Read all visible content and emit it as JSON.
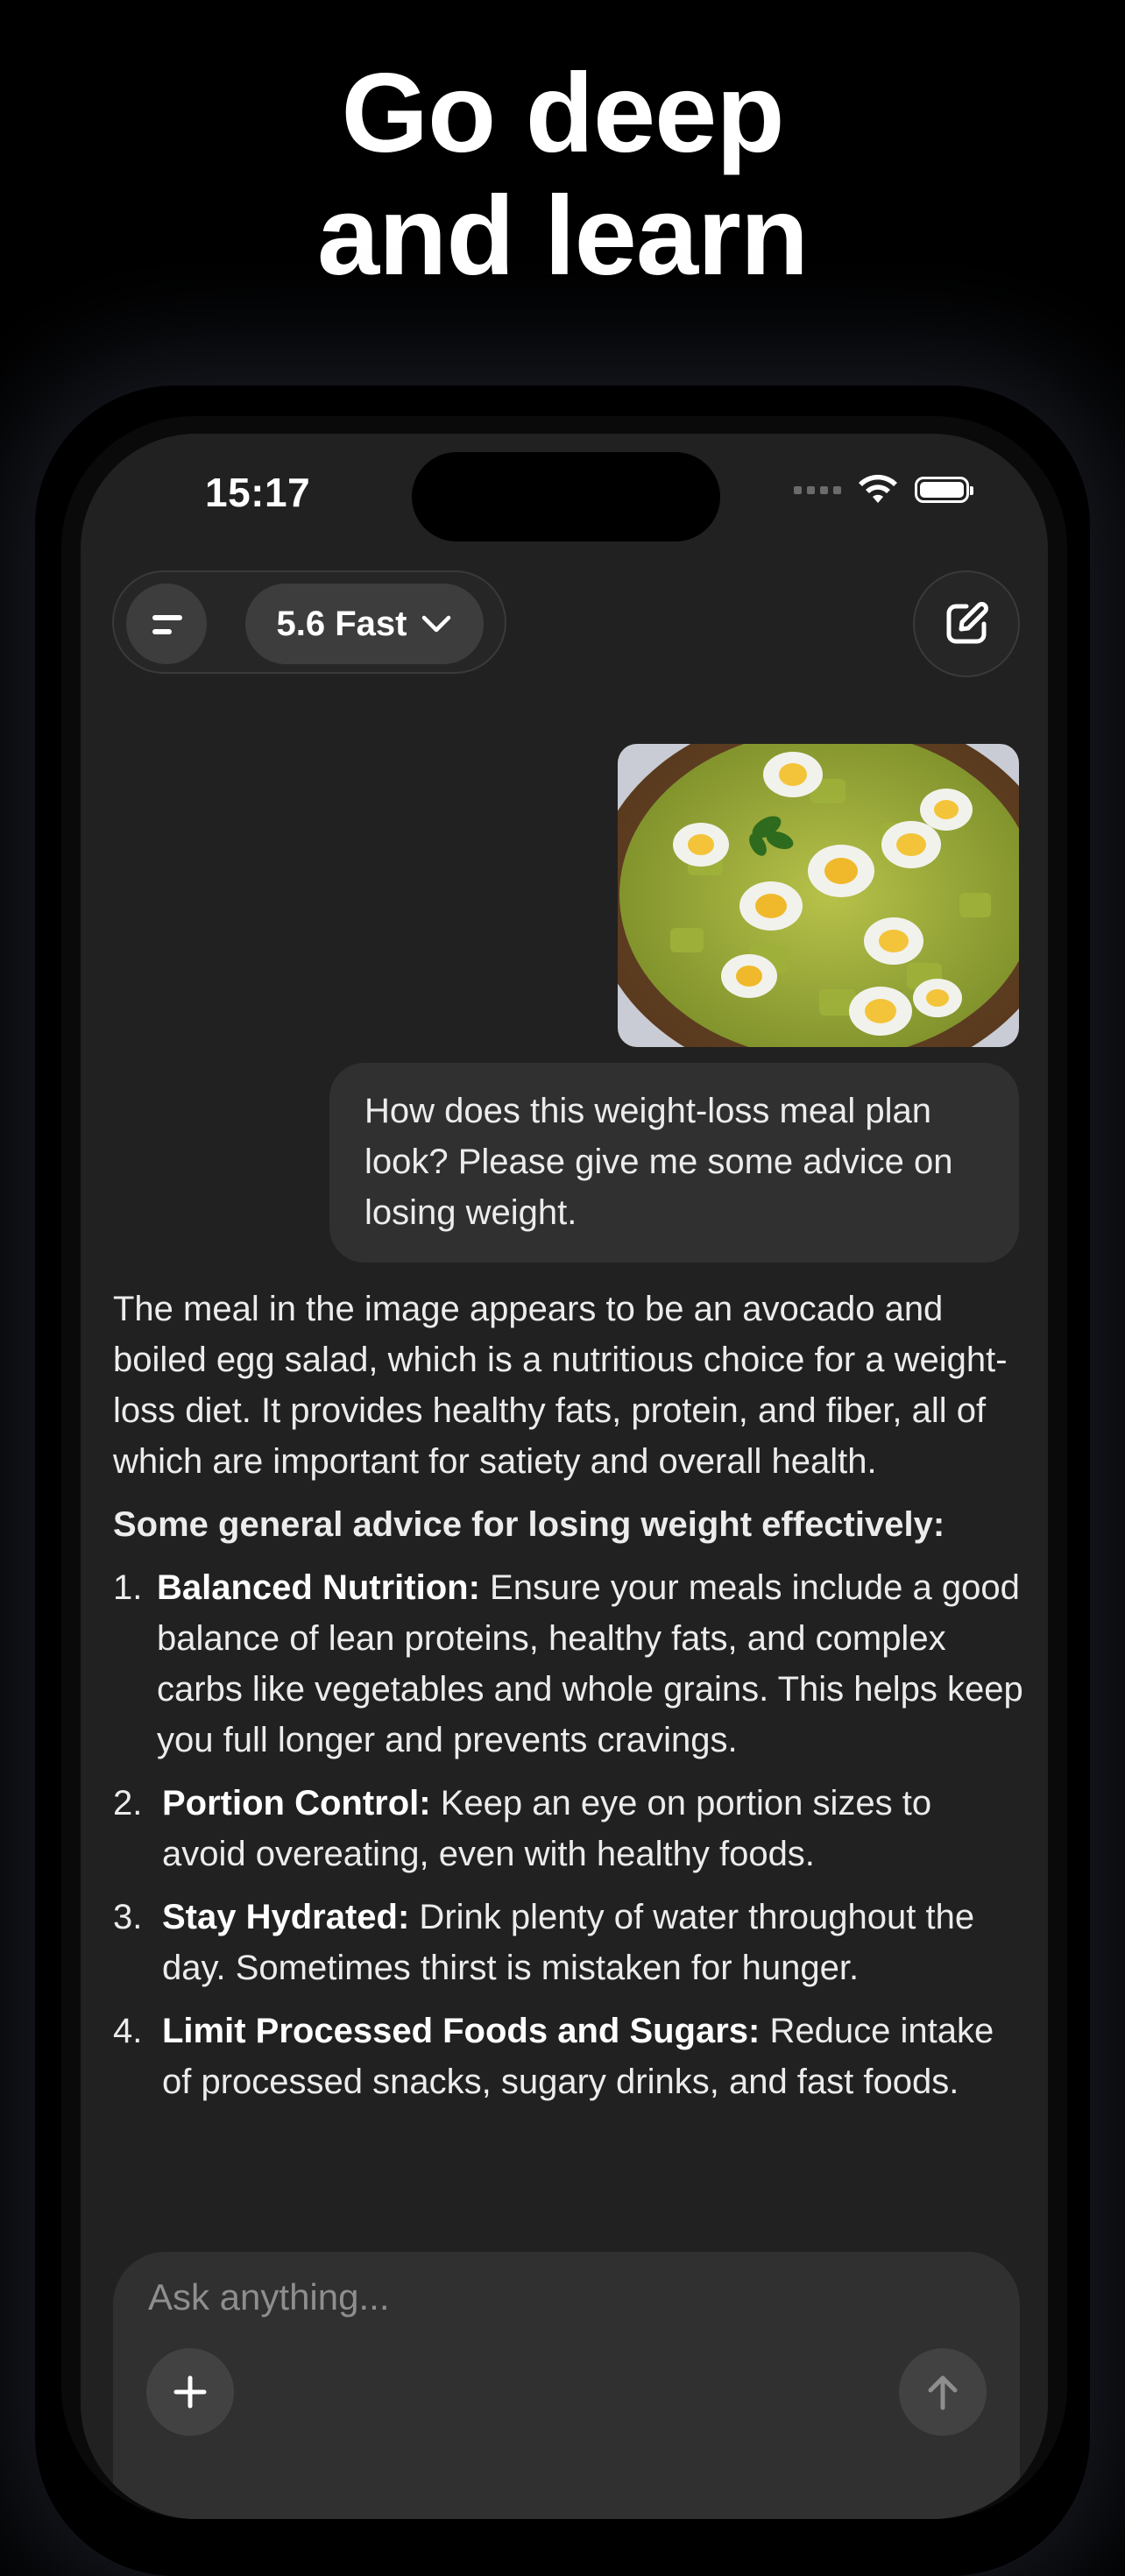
{
  "headline": {
    "line1": "Go deep",
    "line2": "and learn"
  },
  "status_bar": {
    "time": "15:17"
  },
  "toolbar": {
    "model_label": "5.6 Fast"
  },
  "user_message": {
    "text": "How does this weight-loss meal plan look? Please give me some advice on losing weight."
  },
  "assistant_message": {
    "intro": "The meal in the image appears to be an avocado and boiled egg salad, which is a nutritious choice for a weight-loss diet. It provides healthy fats, protein, and fiber, all of which are important for satiety and overall health.",
    "subheading": "Some general advice for losing weight effectively:",
    "items": [
      {
        "num": "1.",
        "title": "Balanced Nutrition:",
        "text": " Ensure your meals include a good balance of lean proteins, healthy fats, and complex carbs like vegetables and whole grains. This helps keep you full longer and prevents cravings."
      },
      {
        "num": "2.",
        "title": "Portion Control:",
        "text": " Keep an eye on portion sizes to avoid overeating, even with healthy foods."
      },
      {
        "num": "3.",
        "title": "Stay Hydrated:",
        "text": " Drink plenty of water throughout the day. Sometimes thirst is mistaken for hunger."
      },
      {
        "num": "4.",
        "title": "Limit Processed Foods and Sugars:",
        "text": " Reduce intake of processed snacks, sugary drinks, and fast foods."
      }
    ]
  },
  "composer": {
    "placeholder": "Ask anything..."
  },
  "colors": {
    "background": "#000000",
    "screen": "#212121",
    "bubble": "#303030",
    "text": "#ececec"
  }
}
